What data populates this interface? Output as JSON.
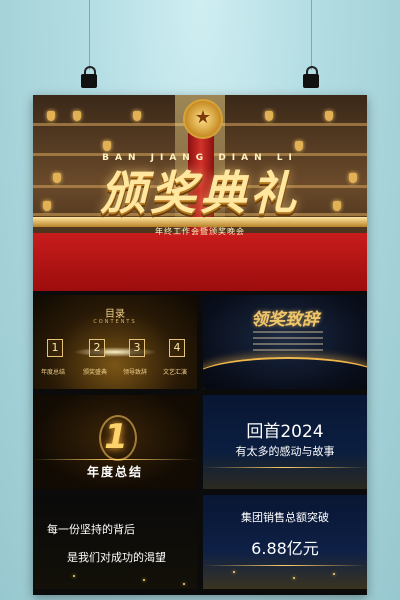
{
  "hero": {
    "title": "颁奖典礼",
    "pinyin": "BAN JIANG DIAN LI",
    "subtitle": "年终工作会暨颁奖晚会"
  },
  "slides": {
    "toc": {
      "title": "目录",
      "subtitle": "CONTENTS",
      "items": [
        {
          "num": "1",
          "label": "年度总结"
        },
        {
          "num": "2",
          "label": "颁奖盛典"
        },
        {
          "num": "3",
          "label": "领导致辞"
        },
        {
          "num": "4",
          "label": "文艺汇演"
        }
      ]
    },
    "ceremony": {
      "title": "领奖致辞"
    },
    "annual": {
      "num": "1",
      "label": "年度总结"
    },
    "review": {
      "line1": "回首2024",
      "line2": "有太多的感动与故事"
    },
    "persist": {
      "line1": "每一份坚持的背后",
      "line2": "是我们对成功的渴望"
    },
    "sales": {
      "line1": "集团销售总额突破",
      "line2": "6.88亿元"
    }
  },
  "colors": {
    "background": "#a9d3da",
    "gold": "#f5cf7a",
    "carpet": "#c81c1c"
  }
}
